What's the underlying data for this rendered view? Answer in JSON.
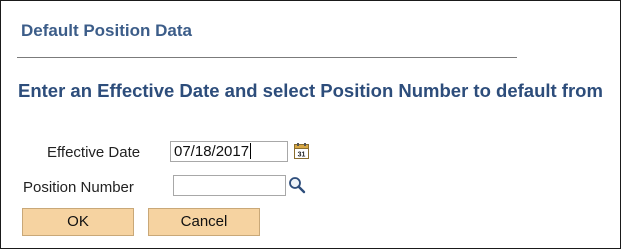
{
  "dialog": {
    "title": "Default Position Data",
    "heading": "Enter an Effective Date and select Position Number to default from"
  },
  "form": {
    "effective_date": {
      "label": "Effective Date",
      "value": "07/18/2017"
    },
    "position_number": {
      "label": "Position Number",
      "value": ""
    }
  },
  "buttons": {
    "ok_label": "OK",
    "cancel_label": "Cancel"
  },
  "icons": {
    "calendar": "calendar-icon",
    "lookup": "magnifier-lookup-icon"
  },
  "colors": {
    "title": "#3c5d89",
    "heading": "#2d4d7b",
    "button_bg": "#f6d3a1"
  }
}
